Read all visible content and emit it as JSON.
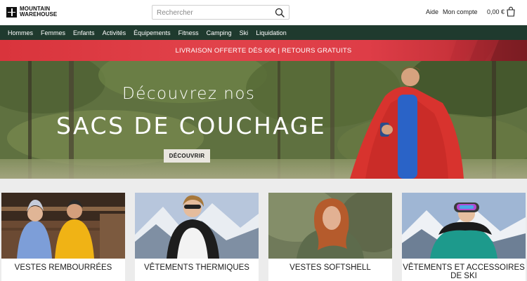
{
  "header": {
    "logo_line1": "MOUNTAIN",
    "logo_line2": "WAREHOUSE",
    "search_placeholder": "Rechercher",
    "help_label": "Aide",
    "account_label": "Mon compte",
    "basket_total": "0,00 €"
  },
  "nav": {
    "items": [
      "Hommes",
      "Femmes",
      "Enfants",
      "Activités",
      "Équipements",
      "Fitness",
      "Camping",
      "Ski",
      "Liquidation"
    ]
  },
  "promo": {
    "text": "LIVRAISON OFFERTE DÈS 60€ | RETOURS GRATUITS"
  },
  "hero": {
    "title_line1": "Découvrez nos",
    "title_line2": "SACS DE COUCHAGE",
    "cta_label": "DÉCOUVRIR"
  },
  "categories": [
    {
      "label": "VESTES REMBOURRÉES"
    },
    {
      "label": "VÊTEMENTS THERMIQUES"
    },
    {
      "label": "VESTES SOFTSHELL"
    },
    {
      "label": "VÊTEMENTS ET ACCESSOIRES DE SKI"
    }
  ],
  "colors": {
    "nav_bg": "#1f3a2e",
    "promo_red": "#de3d47",
    "cta_bg": "#e9e6df"
  },
  "icons": {
    "search": "search-icon",
    "bag": "bag-icon",
    "logo": "logo-cross-icon"
  }
}
